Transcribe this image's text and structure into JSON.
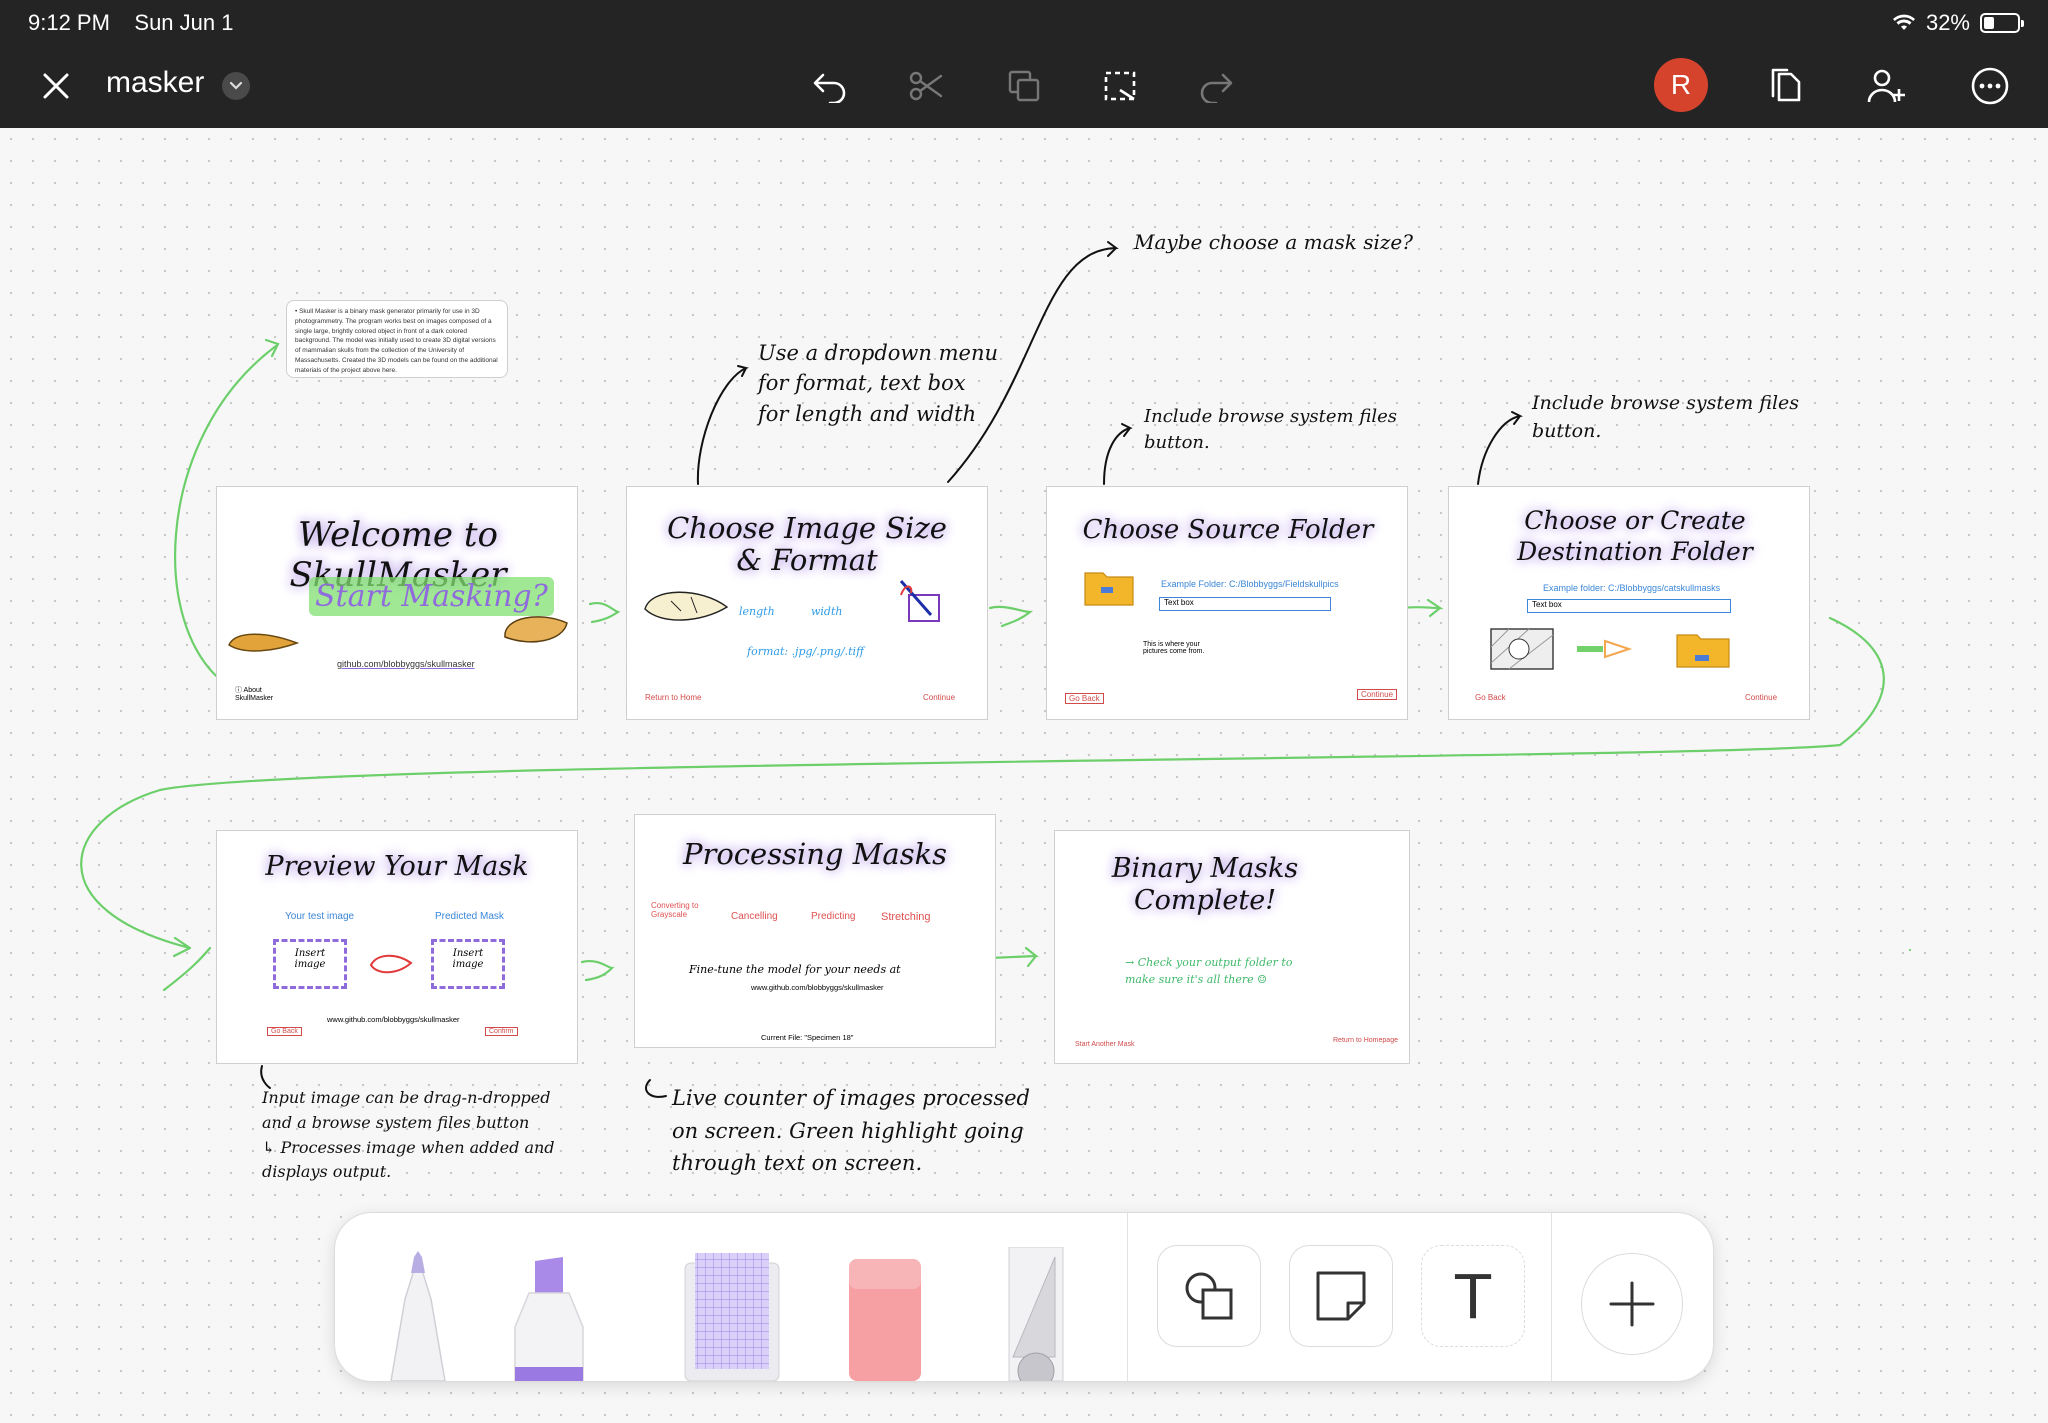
{
  "status_bar": {
    "time": "9:12 PM",
    "date": "Sun Jun 1",
    "battery": "32%",
    "battery_level": 0.32
  },
  "toolbar": {
    "title": "masker",
    "avatar_initial": "R"
  },
  "colors": {
    "accent_avatar": "#d6432d",
    "flow_arrow": "#6ccf6a",
    "highlight_purple": "#b69be6"
  },
  "about_card": {
    "text": "• Skull Masker is a binary mask generator primarily for use in 3D photogrammetry. The program works best on images composed of a single large, brightly colored object in front of a dark colored background. The model was initially used to create 3D digital versions of mammalian skulls from the collection of the University of Massachusetts. Created the 3D models can be found on the additional materials of the project above here."
  },
  "annotations": {
    "dropdown": "Use a dropdown menu\nfor format, text box\nfor length and width",
    "mask_size": "Maybe choose a mask size?",
    "browse1": "Include browse system files\nbutton.",
    "browse2": "Include browse system files\nbutton.",
    "input_image": "Input image can be drag-n-dropped\nand a browse system files button\n↳ Processes image when added and\ndisplays output.",
    "live_counter": "Live counter of images processed\non screen. Green highlight going\nthrough text on screen."
  },
  "slides": {
    "welcome": {
      "title": "Welcome to SkullMasker",
      "cta": "Start Masking?",
      "link": "github.com/blobbyggs/skullmasker",
      "about": "ⓘ About SkullMasker"
    },
    "size": {
      "title": "Choose Image Size\n& Format",
      "length": "length",
      "width": "width",
      "format": "format: .jpg/.png/.tiff",
      "back": "Return to Home",
      "next": "Continue"
    },
    "source": {
      "title": "Choose Source Folder",
      "example": "Example Folder: C:/Blobbyggs/Fieldskullpics",
      "textbox": "Text box",
      "hint": "This is where your pictures come from.",
      "back": "Go Back",
      "next": "Continue"
    },
    "dest": {
      "title": "Choose or Create\nDestination Folder",
      "example": "Example folder: C:/Blobbyggs/catskullmasks",
      "textbox": "Text box",
      "back": "Go Back",
      "next": "Continue"
    },
    "preview": {
      "title": "Preview Your Mask",
      "left_label": "Your test image",
      "right_label": "Predicted Mask",
      "insert1": "Insert\nimage",
      "insert2": "Insert\nimage",
      "link": "www.github.com/blobbyggs/skullmasker",
      "back": "Go Back",
      "next": "Confirm"
    },
    "processing": {
      "title": "Processing Masks",
      "steps": [
        "Converting to Grayscale",
        "Cancelling",
        "Predicting",
        "Stretching"
      ],
      "finetune": "Fine-tune the model for your needs at",
      "link": "www.github.com/blobbyggs/skullmasker",
      "current": "Current File: \"Specimen 18\""
    },
    "complete": {
      "title": "Binary Masks\nComplete!",
      "message": "→ Check your output folder to\nmake sure it's all there ☺",
      "left": "Start Another Mask",
      "right": "Return to Homepage"
    }
  },
  "tools": {
    "pen": "pen",
    "marker": "marker",
    "washi_tape": "washi tape",
    "eraser": "eraser",
    "ruler": "ruler",
    "shapes": "shapes",
    "sticky_note": "sticky note",
    "text": "T",
    "add": "add"
  }
}
